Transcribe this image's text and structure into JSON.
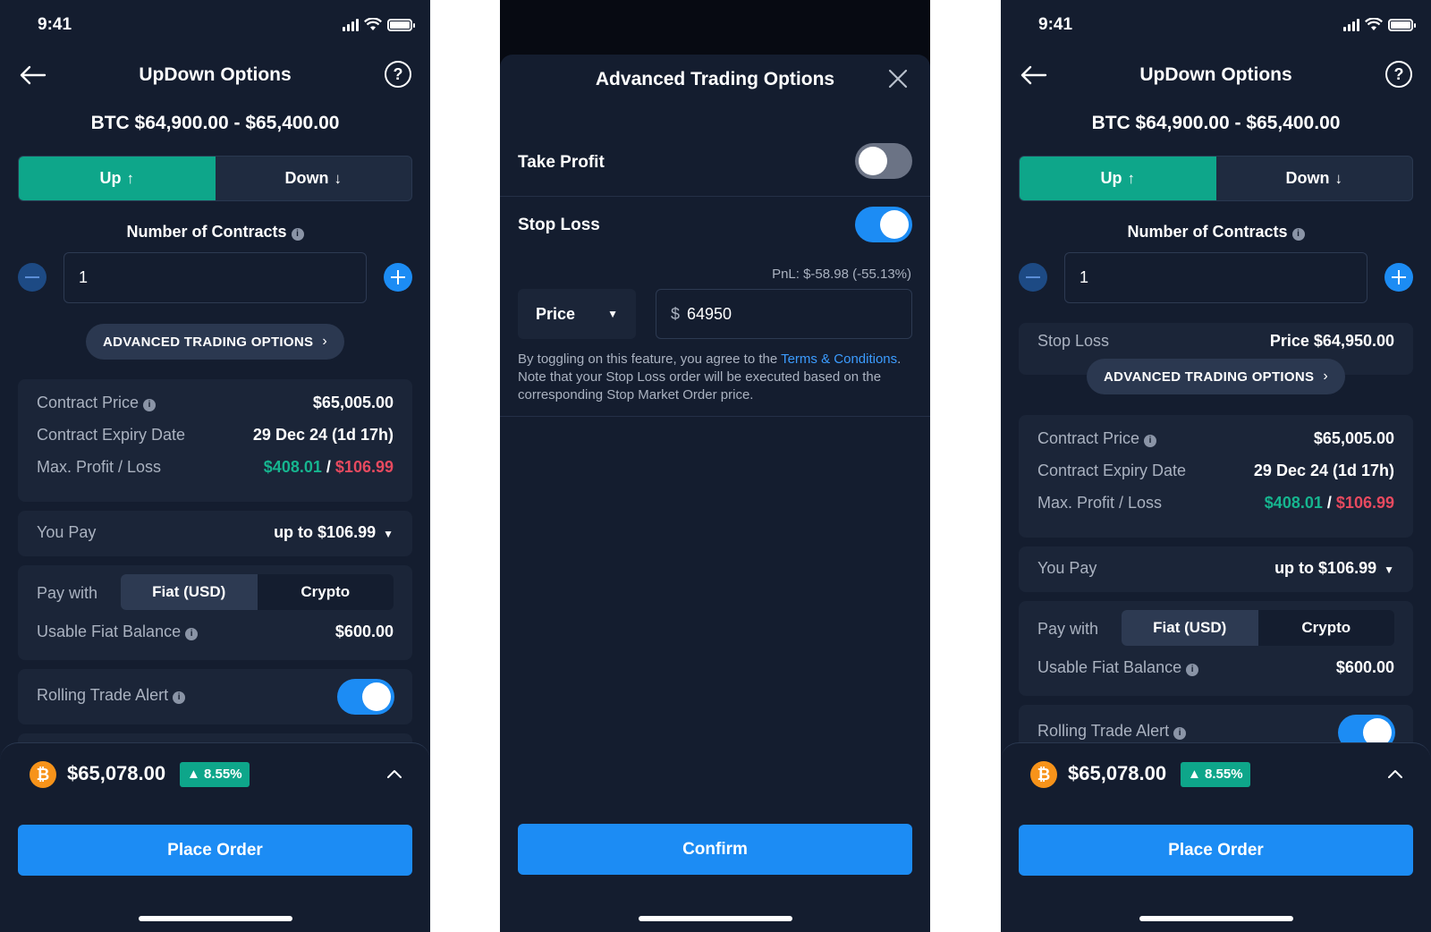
{
  "status": {
    "time": "9:41"
  },
  "order": {
    "title": "UpDown Options",
    "help": "?",
    "price_range": "BTC $64,900.00 - $65,400.00",
    "up_label": "Up",
    "down_label": "Down",
    "up_arrow": "↑",
    "down_arrow": "↓",
    "contracts_label": "Number of Contracts",
    "contracts_value": "1",
    "advanced_label": "ADVANCED TRADING OPTIONS",
    "chevron": "›",
    "contract_price_label": "Contract Price",
    "contract_price_value": "$65,005.00",
    "expiry_label": "Contract Expiry Date",
    "expiry_value": "29 Dec 24 (1d 17h)",
    "max_pl_label": "Max. Profit / Loss",
    "max_profit": "$408.01",
    "pl_separator": "/",
    "max_loss": "$106.99",
    "you_pay_label": "You Pay",
    "you_pay_value": "up to $106.99",
    "caret": "▼",
    "pay_with_label": "Pay with",
    "pay_fiat": "Fiat (USD)",
    "pay_crypto": "Crypto",
    "fiat_balance_label": "Usable Fiat Balance",
    "fiat_balance_value": "$600.00",
    "rolling_alert_label": "Rolling Trade Alert",
    "stop_loss_label": "Stop Loss",
    "stop_loss_value": "Price $64,950.00",
    "btc_symbol": "₿",
    "btc_price": "$65,078.00",
    "btc_change": "▲ 8.55%",
    "place_order": "Place Order",
    "info": "i"
  },
  "modal": {
    "title": "Advanced Trading Options",
    "take_profit_label": "Take Profit",
    "stop_loss_label": "Stop Loss",
    "pnl": "PnL: $-58.98 (-55.13%)",
    "trigger_type": "Price",
    "caret": "▼",
    "currency": "$",
    "price_value": "64950",
    "disclaimer_pre": "By toggling on this feature, you agree to the ",
    "terms_link": "Terms & Conditions",
    "disclaimer_post": ". Note that your Stop Loss order will be executed based on the corresponding Stop Market Order price.",
    "confirm": "Confirm"
  },
  "colors": {
    "background": "#141d2f",
    "up_green": "#0ea68a",
    "profit_green": "#16b58f",
    "loss_red": "#e84a5f",
    "primary_blue": "#1c8cf4"
  }
}
